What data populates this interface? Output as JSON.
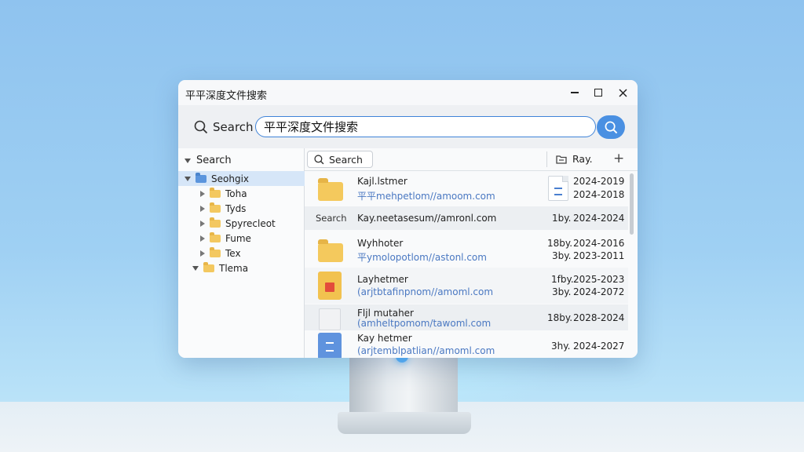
{
  "window": {
    "title": "平平深度文件搜索",
    "controls": {
      "minimize": "minimize",
      "maximize": "maximize",
      "close": "close"
    }
  },
  "search": {
    "label": "Search",
    "query": "平平深度文件搜索",
    "button_icon": "search-icon"
  },
  "sidebar": {
    "header": "Search",
    "items": [
      {
        "label": "Seohgix",
        "selected": true,
        "expanded": true,
        "color": "#5b95dd"
      },
      {
        "label": "Toha"
      },
      {
        "label": "Tyds"
      },
      {
        "label": "Spyrecleot"
      },
      {
        "label": "Fume"
      },
      {
        "label": "Tex"
      },
      {
        "label": "Tlema",
        "expanded": true
      }
    ]
  },
  "toolbar": {
    "tab_label": "Search",
    "ray_label": "Ray.",
    "add_label": "+"
  },
  "results": [
    {
      "icon": "folder-icon",
      "name": "Kajl.lstmer",
      "path": "平平mehpetlom//amoom.com",
      "doc_icon": "document-icon",
      "date1": "2024-2019",
      "date2": "2024-2018"
    },
    {
      "kind": "Search",
      "name": "Kay.neetasesum//amronl.com",
      "size": "1by.",
      "date1": "2024-2024"
    },
    {
      "icon": "folder-icon",
      "name": "Wyhhoter",
      "path": "平ymolopotlom//astonl.com",
      "size1": "18by.",
      "date1": "2024-2016",
      "size2": "3by.",
      "date2": "2023-2011"
    },
    {
      "icon": "pdf-icon",
      "name": "Layhetmer",
      "path": "(arjtbtafinpnom//amoml.com",
      "size1": "1fby.",
      "date1": "2025-2023",
      "size2": "3by.",
      "date2": "2024-2072"
    },
    {
      "icon": "blank-file-icon",
      "name": "Fljl mutaher",
      "path": "(amheltpomom/tawoml.com",
      "size1": "18by.",
      "date1": "2028-2024"
    },
    {
      "icon": "text-file-icon",
      "name": "Kay hetmer",
      "path": "(arjtemblpatlian//amoml.com",
      "size1": "3hy.",
      "date1": "2024-2027"
    }
  ]
}
